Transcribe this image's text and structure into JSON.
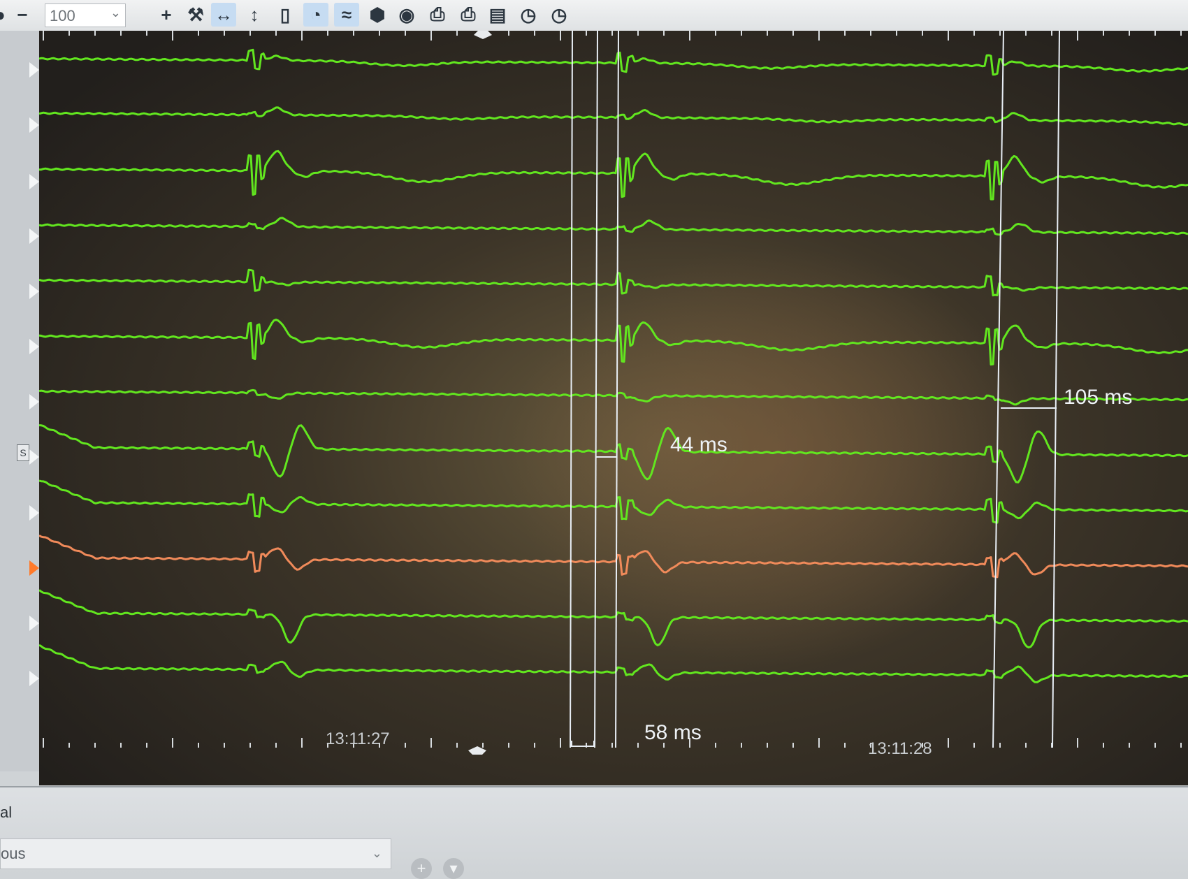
{
  "toolbar": {
    "zoom_value": "100",
    "zoom_minus": "−",
    "tools": [
      {
        "icon": "plus-icon",
        "glyph": "+"
      },
      {
        "icon": "tools-icon",
        "glyph": "⚒"
      },
      {
        "icon": "fit-horizontal-icon",
        "glyph": "↔"
      },
      {
        "icon": "fit-vertical-icon",
        "glyph": "↕"
      },
      {
        "icon": "clipboard-icon",
        "glyph": "▯"
      },
      {
        "icon": "caliper-icon",
        "glyph": "◔"
      },
      {
        "icon": "waveform-icon",
        "glyph": "≈"
      },
      {
        "icon": "shield-icon",
        "glyph": "⬢"
      },
      {
        "icon": "camera-icon",
        "glyph": "◉"
      },
      {
        "icon": "print-icon",
        "glyph": "⎙"
      },
      {
        "icon": "print-preview-icon",
        "glyph": "⎙"
      },
      {
        "icon": "document-print-icon",
        "glyph": "▤"
      },
      {
        "icon": "history-icon",
        "glyph": "◷"
      },
      {
        "icon": "clock-icon",
        "glyph": "◷"
      }
    ]
  },
  "gutter": {
    "selected_channel_badge": "S"
  },
  "colors": {
    "trace": "#62e61f",
    "trace_selected": "#f08a5a",
    "caliper": "#e8eef5",
    "background": "#2a2620"
  },
  "measurements": [
    {
      "label": "105 ms"
    },
    {
      "label": "44 ms"
    },
    {
      "label": "58 ms"
    }
  ],
  "time_labels": [
    "13:11:27",
    "13:11:28"
  ],
  "bottom": {
    "panel_label": "al",
    "dropdown_value": "ous"
  }
}
